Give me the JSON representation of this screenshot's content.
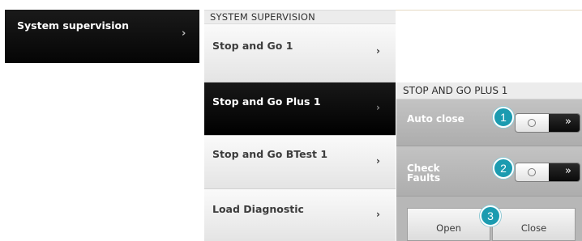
{
  "main_menu": {
    "items": [
      {
        "label": "System supervision",
        "chevron": "›"
      }
    ]
  },
  "submenu": {
    "header": "SYSTEM SUPERVISION",
    "items": [
      {
        "label": "Stop and Go 1",
        "chevron": "›",
        "active": false
      },
      {
        "label": "Stop and Go Plus 1",
        "chevron": "›",
        "active": true
      },
      {
        "label": "Stop and Go BTest 1",
        "chevron": "›",
        "active": false
      },
      {
        "label": "Load Diagnostic",
        "chevron": "›",
        "active": false
      }
    ]
  },
  "detail": {
    "header": "STOP AND GO PLUS 1",
    "settings": [
      {
        "label": "Auto close",
        "state": "off",
        "off_symbol": "○",
        "on_symbol": "»",
        "callout": "1"
      },
      {
        "label": "Check\nFaults",
        "label_line1": "Check",
        "label_line2": "Faults",
        "state": "off",
        "off_symbol": "○",
        "on_symbol": "»",
        "callout": "2"
      }
    ],
    "buttons": {
      "open_label": "Open",
      "close_label": "Close",
      "callout": "3"
    }
  },
  "colors": {
    "callout": "#1b9bb0",
    "active_bg": "#000000",
    "panel_bg": "#b7b7b7"
  },
  "icons": {
    "chevron": "chevron-right-icon",
    "toggle_off": "circle-icon",
    "toggle_on": "double-chevron-right-icon"
  }
}
